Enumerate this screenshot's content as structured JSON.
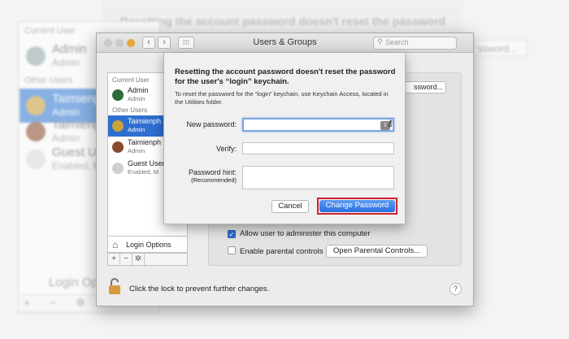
{
  "background": {
    "current_user_header": "Current User",
    "other_users_header": "Other Users",
    "users": [
      {
        "name": "Admin",
        "role": "Admin"
      },
      {
        "name": "Taimienp",
        "role": "Admin"
      },
      {
        "name": "Taimienp",
        "role": "Admin"
      },
      {
        "name": "Guest Us",
        "role": "Enabled, M"
      }
    ],
    "sheet_title": "Resetting the account password doesn't reset the password",
    "password_button": "ssword...",
    "login_options": "Login Op",
    "toolbar": "+ − ✲"
  },
  "window": {
    "title": "Users & Groups",
    "search_placeholder": "Search",
    "nav_back": "‹",
    "nav_forward": "›",
    "grid": "⁝⁝⁝"
  },
  "sidebar": {
    "current_user_header": "Current User",
    "other_users_header": "Other Users",
    "users": [
      {
        "name": "Admin",
        "role": "Admin",
        "avatar_color": "#2e6b3a"
      },
      {
        "name": "Taimienph",
        "role": "Admin",
        "avatar_color": "#c9a23c"
      },
      {
        "name": "Taimienph",
        "role": "Admin",
        "avatar_color": "#8a4a2c"
      },
      {
        "name": "Guest User",
        "role": "Enabled, M",
        "avatar_color": "#cfcfcf"
      }
    ],
    "login_options": "Login Options",
    "add": "+",
    "remove": "−",
    "gear": "✲"
  },
  "panel": {
    "reset_password_button": "ssword...",
    "allow_admin_label": "Allow user to administer this computer",
    "allow_admin_checked": true,
    "parental_label": "Enable parental controls",
    "parental_checked": false,
    "open_parental_button": "Open Parental Controls...",
    "lock_text": "Click the lock to prevent further changes.",
    "help": "?"
  },
  "dialog": {
    "title": "Resetting the account password doesn't reset the password for the user's “login” keychain.",
    "body": "To reset the password for the “login” keychain, use Keychain Access, located in the Utilities folder.",
    "new_password_label": "New password:",
    "new_password_value": "",
    "verify_label": "Verify:",
    "verify_value": "",
    "hint_label": "Password hint:",
    "hint_sub": "(Recommended)",
    "hint_value": "",
    "cancel_button": "Cancel",
    "change_button": "Change Password",
    "highlight_color": "#d0202a",
    "accent_color": "#2a6fe0"
  }
}
